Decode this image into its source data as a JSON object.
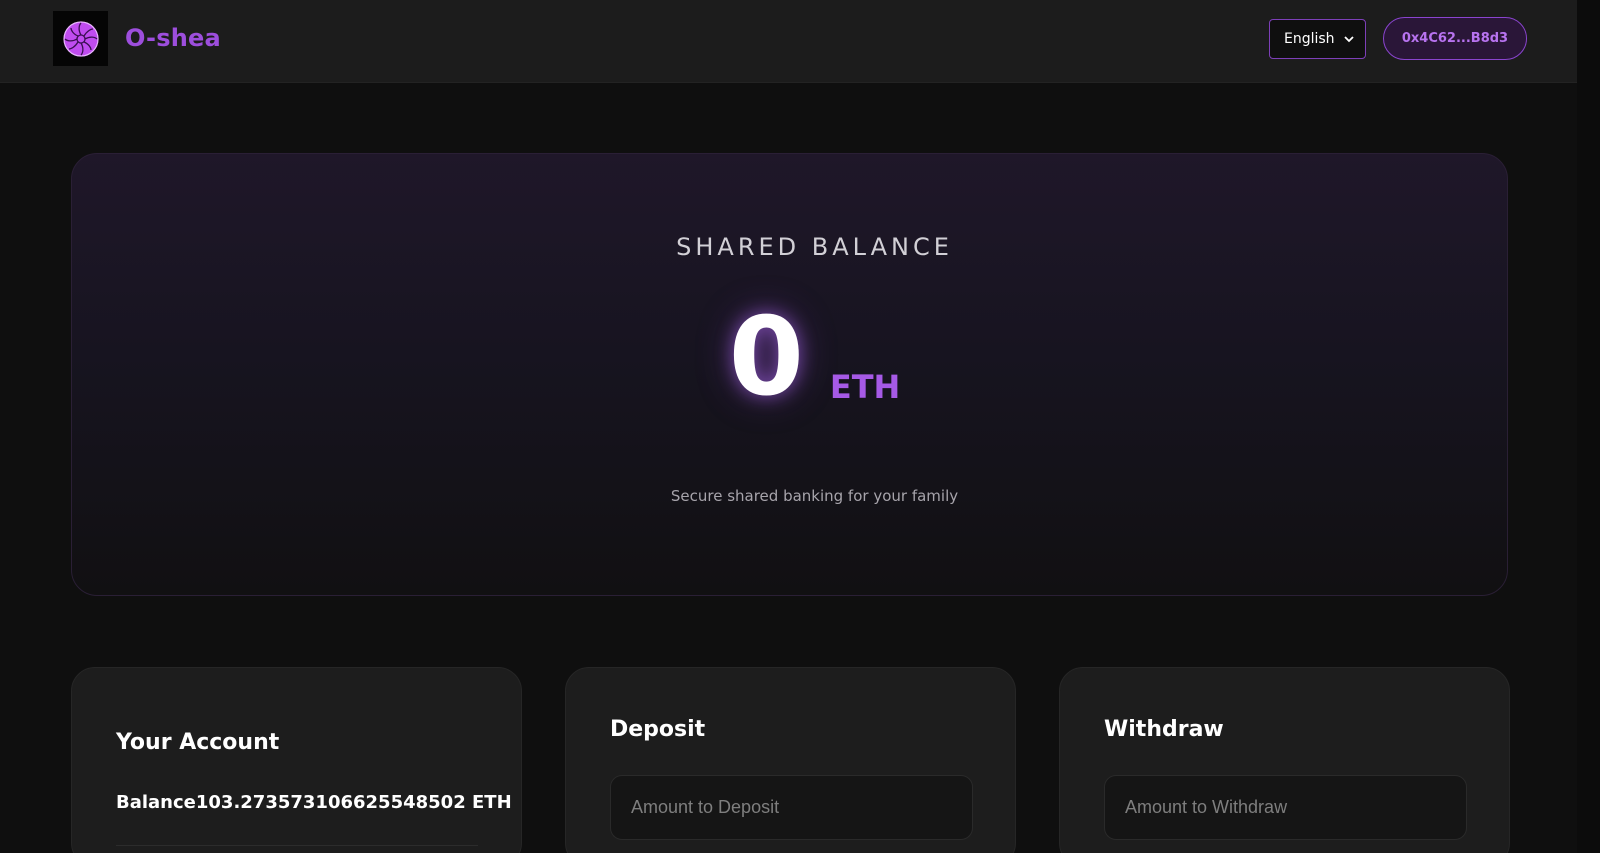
{
  "header": {
    "brand": "O-shea",
    "logo_icon": "lotus-logo-icon",
    "language": {
      "selected": "English",
      "options": [
        "English"
      ]
    },
    "wallet_address": "0x4C62...B8d3"
  },
  "hero": {
    "title": "SHARED BALANCE",
    "amount": "0",
    "unit": "ETH",
    "subtitle": "Secure shared banking for your family"
  },
  "account": {
    "title": "Your Account",
    "balance_text": "Balance103.273573106625548502 ETH"
  },
  "deposit": {
    "title": "Deposit",
    "placeholder": "Amount to Deposit"
  },
  "withdraw": {
    "title": "Withdraw",
    "placeholder": "Amount to Withdraw"
  },
  "colors": {
    "accent": "#9d4edd",
    "background": "#0f0f0f",
    "header_bg": "#1c1c1c",
    "card_bg": "#1d1d1d"
  }
}
